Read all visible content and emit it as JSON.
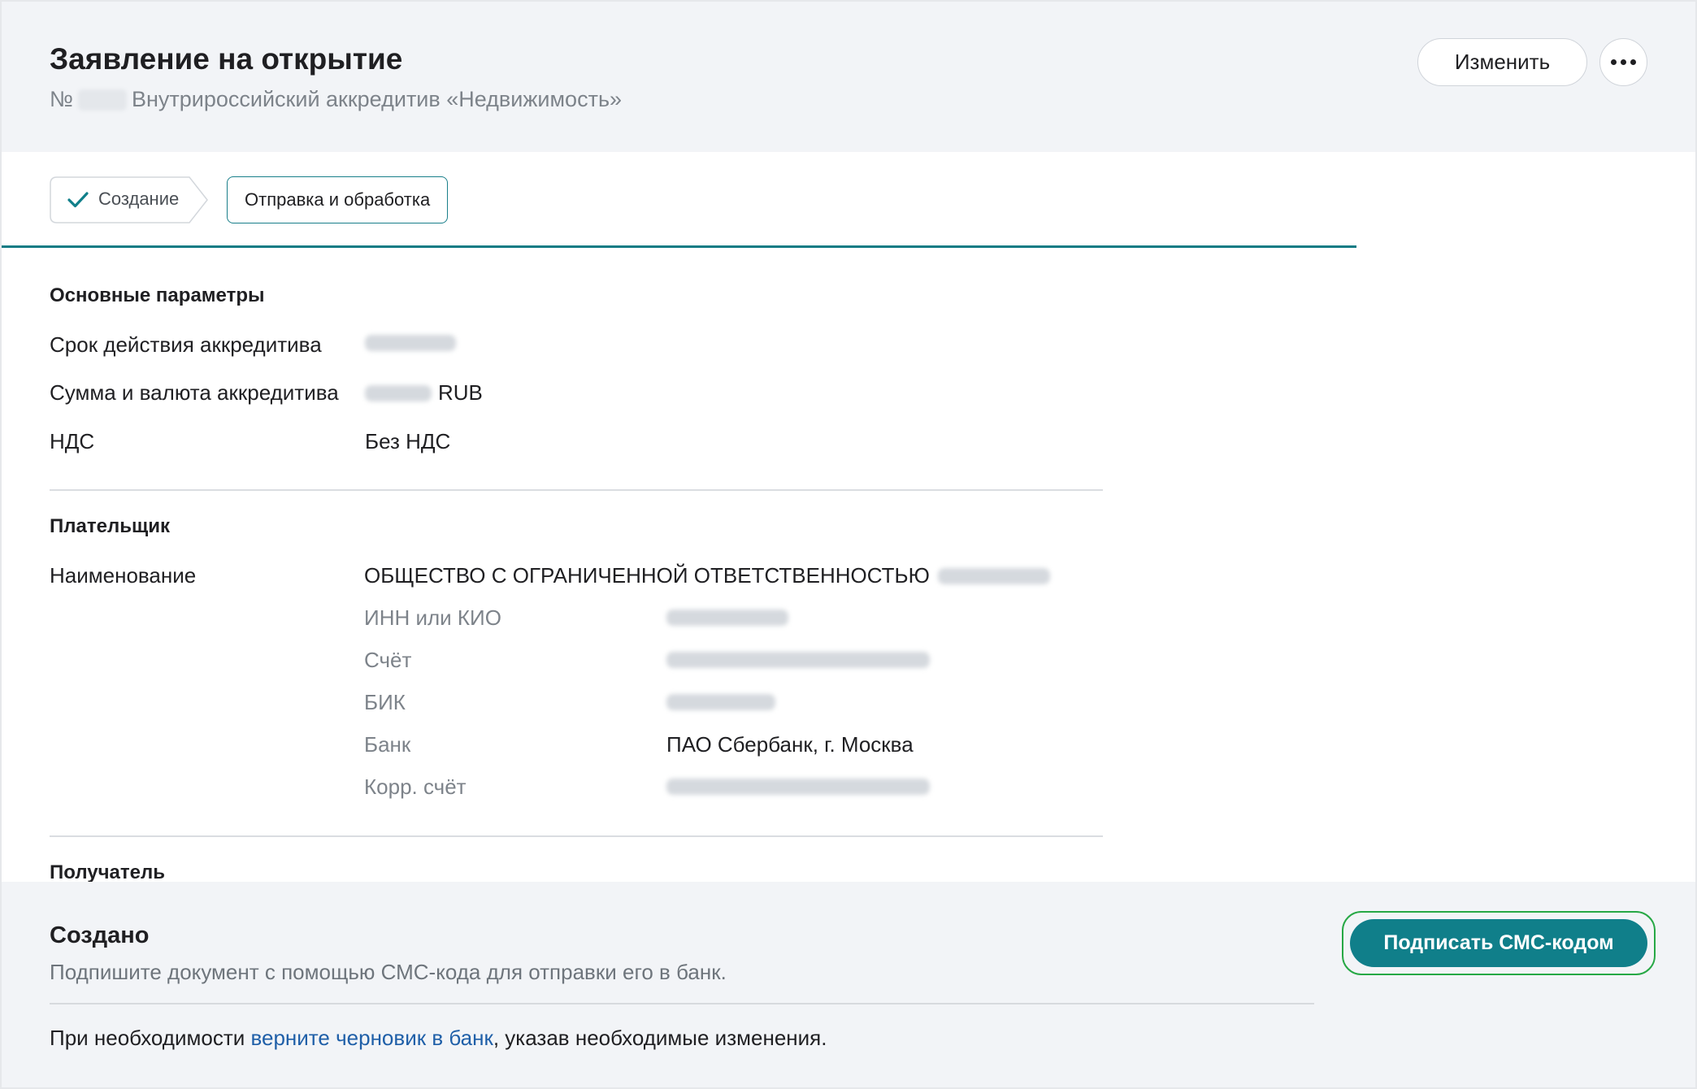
{
  "header": {
    "title": "Заявление на открытие",
    "number_prefix": "№",
    "document_type": "Внутрироссийский аккредитив «Недвижимость»",
    "edit_label": "Изменить"
  },
  "steps": [
    {
      "label": "Создание",
      "state": "completed"
    },
    {
      "label": "Отправка и обработка",
      "state": "current"
    }
  ],
  "main_params": {
    "title": "Основные параметры",
    "rows": [
      {
        "label": "Срок действия аккредитива",
        "value_suffix": ""
      },
      {
        "label": "Сумма и валюта аккредитива",
        "value_suffix": "RUB"
      },
      {
        "label": "НДС",
        "value": "Без НДС"
      }
    ]
  },
  "payer": {
    "title": "Плательщик",
    "name_label": "Наименование",
    "name_value": "ОБЩЕСТВО С ОГРАНИЧЕННОЙ ОТВЕТСТВЕННОСТЬЮ",
    "details": [
      {
        "label": "ИНН или КИО"
      },
      {
        "label": "Счёт"
      },
      {
        "label": "БИК"
      },
      {
        "label": "Банк",
        "value": "ПАО Сбербанк, г. Москва"
      },
      {
        "label": "Корр. счёт"
      }
    ]
  },
  "recipient": {
    "title": "Получатель"
  },
  "status": {
    "title": "Создано",
    "description": "Подпишите документ с помощью СМС-кода для отправки его в банк.",
    "note_before": "При необходимости ",
    "note_link": "верните черновик в банк",
    "note_after": ", указав необходимые изменения.",
    "sign_button": "Подписать СМС-кодом"
  },
  "colors": {
    "accent": "#107f8a",
    "focus_ring": "#27a845",
    "link": "#1f5fa8",
    "header_bg": "#f2f4f7"
  }
}
